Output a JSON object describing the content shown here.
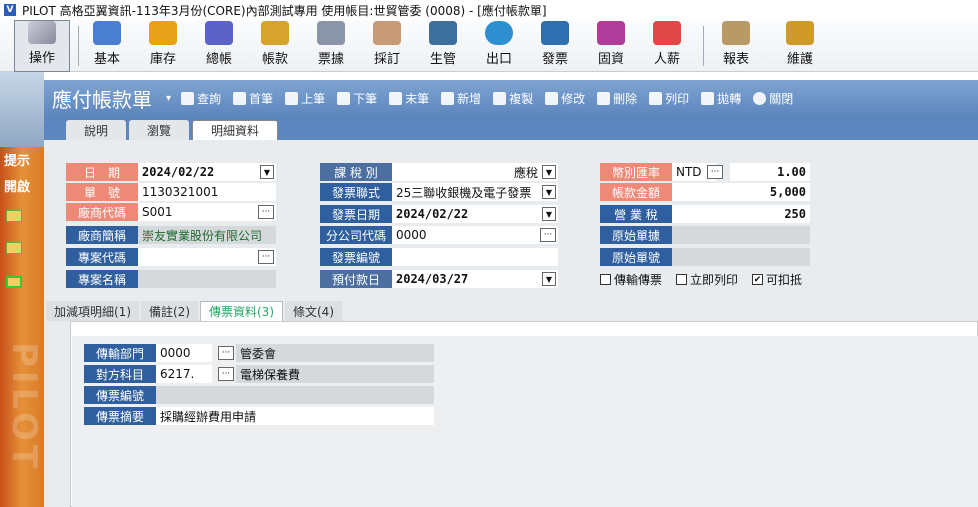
{
  "window": {
    "title": "PILOT 高格亞翼資訊-113年3月份(CORE)內部測試專用 使用帳目:世貿管委 (0008) - [應付帳款單]"
  },
  "toolbar": [
    "操作",
    "基本",
    "庫存",
    "總帳",
    "帳款",
    "票據",
    "採訂",
    "生管",
    "出口",
    "發票",
    "固資",
    "人薪",
    "報表",
    "維護"
  ],
  "form": {
    "title": "應付帳款單",
    "actions": [
      "查詢",
      "首筆",
      "上筆",
      "下筆",
      "末筆",
      "新增",
      "複製",
      "修改",
      "刪除",
      "列印",
      "拋轉",
      "關閉"
    ],
    "tabs": [
      "說明",
      "瀏覽",
      "明細資料"
    ]
  },
  "sidebar": {
    "hint": "提示",
    "open": "開啟",
    "brand": "PILOT"
  },
  "fields": {
    "date_label": "日　期",
    "date_value": "2024/02/22",
    "voucher_label": "單　號",
    "voucher_value": "1130321001",
    "vendor_code_label": "廠商代碼",
    "vendor_code_value": "S001",
    "vendor_name_label": "廠商簡稱",
    "vendor_name_value": "崇友實業股份有限公司",
    "project_code_label": "專案代碼",
    "project_code_value": "",
    "project_name_label": "專案名稱",
    "project_name_value": "",
    "tax_type_label": "課 稅 別",
    "tax_type_value": "應稅",
    "invoice_format_label": "發票聯式",
    "invoice_format_value": "25三聯收銀機及電子發票",
    "invoice_date_label": "發票日期",
    "invoice_date_value": "2024/02/22",
    "branch_code_label": "分公司代碼",
    "branch_code_value": "0000",
    "invoice_no_label": "發票編號",
    "invoice_no_value": "",
    "due_date_label": "預付款日",
    "due_date_value": "2024/03/27",
    "currency_label": "幣別匯率",
    "currency_code": "NTD",
    "currency_rate": "1.00",
    "amount_label": "帳款金額",
    "amount_value": "5,000",
    "tax_label": "營 業 稅",
    "tax_value": "250",
    "orig_doc_label": "原始單據",
    "orig_doc_value": "",
    "orig_no_label": "原始單號",
    "orig_no_value": "",
    "chk_transfer": "傳輸傳票",
    "chk_print": "立即列印",
    "chk_deduct": "可扣抵"
  },
  "subtabs": [
    "加減項明細(1)",
    "備註(2)",
    "傳票資料(3)",
    "條文(4)"
  ],
  "voucher": {
    "dept_label": "傳輸部門",
    "dept_code": "0000",
    "dept_name": "管委會",
    "account_label": "對方科目",
    "account_code": "6217.",
    "account_name": "電梯保養費",
    "number_label": "傳票編號",
    "number_value": "",
    "summary_label": "傳票摘要",
    "summary_value": "採購經辦費用申請"
  },
  "colors": {
    "accent": "#5d86be",
    "label_red": "#ee8877",
    "label_blue": "#2f5f9e"
  },
  "checks": {
    "transfer": false,
    "print": false,
    "deduct": true
  }
}
